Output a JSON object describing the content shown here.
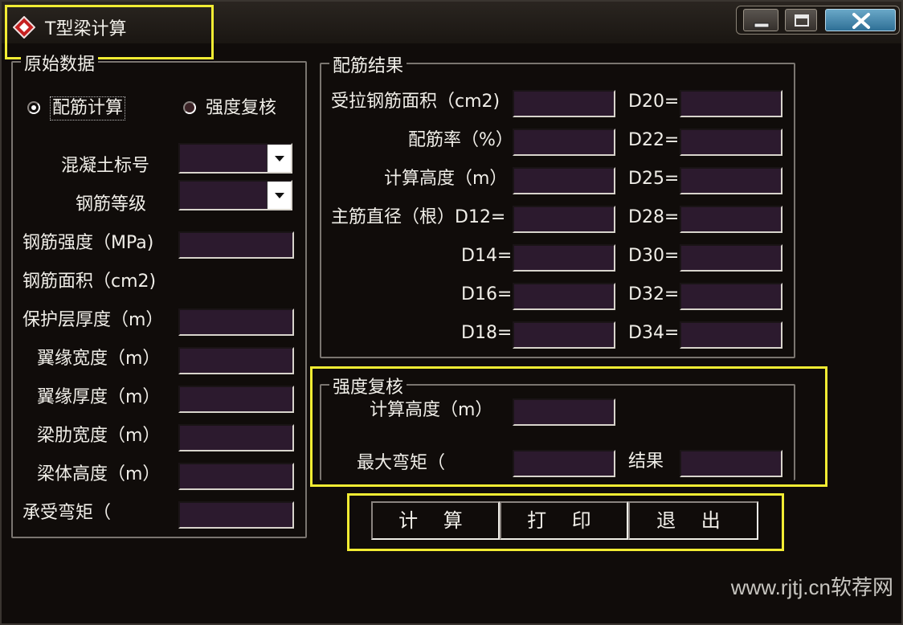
{
  "window": {
    "title": "T型梁计算",
    "controls": {
      "minimize": "minimize",
      "maximize": "maximize",
      "close": "close"
    }
  },
  "original_data": {
    "legend": "原始数据",
    "radio_reinforcement": "配筋计算",
    "radio_strength": "强度复核",
    "concrete_grade_label": "混凝土标号",
    "concrete_grade_value": "",
    "steel_grade_label": "钢筋等级",
    "steel_grade_value": "",
    "steel_strength_label": "钢筋强度（MPa)",
    "steel_area_label": "钢筋面积（cm2)",
    "cover_label": "保护层厚度（m）",
    "flange_width_label": "翼缘宽度（m）",
    "flange_thickness_label": "翼缘厚度（m）",
    "rib_width_label": "梁肋宽度（m）",
    "beam_height_label": "梁体高度（m）",
    "moment_label": "承受弯矩（"
  },
  "result": {
    "legend": "配筋结果",
    "tension_area_label": "受拉钢筋面积（cm2)",
    "ratio_label": "配筋率（%）",
    "calc_height_label": "计算高度（m）",
    "main_bar_label": "主筋直径（根）D12=",
    "d14": "D14=",
    "d16": "D16=",
    "d18": "D18=",
    "d20": "D20=",
    "d22": "D22=",
    "d25": "D25=",
    "d28": "D28=",
    "d30": "D30=",
    "d32": "D32=",
    "d34": "D34="
  },
  "strength_check": {
    "legend": "强度复核",
    "calc_height_label": "计算高度（m）",
    "max_moment_label": "最大弯矩（",
    "result_label": "结果"
  },
  "buttons": {
    "calculate": "计 算",
    "print": "打 印",
    "exit": "退 出"
  },
  "watermark": "www.rjtj.cn软荐网",
  "colors": {
    "field_bg": "#2c1a2e",
    "highlight": "#f2ec33",
    "close_button": "#3a83ad"
  },
  "icons": {
    "app": "red-diamond-icon",
    "dropdown": "chevron-down-icon"
  }
}
